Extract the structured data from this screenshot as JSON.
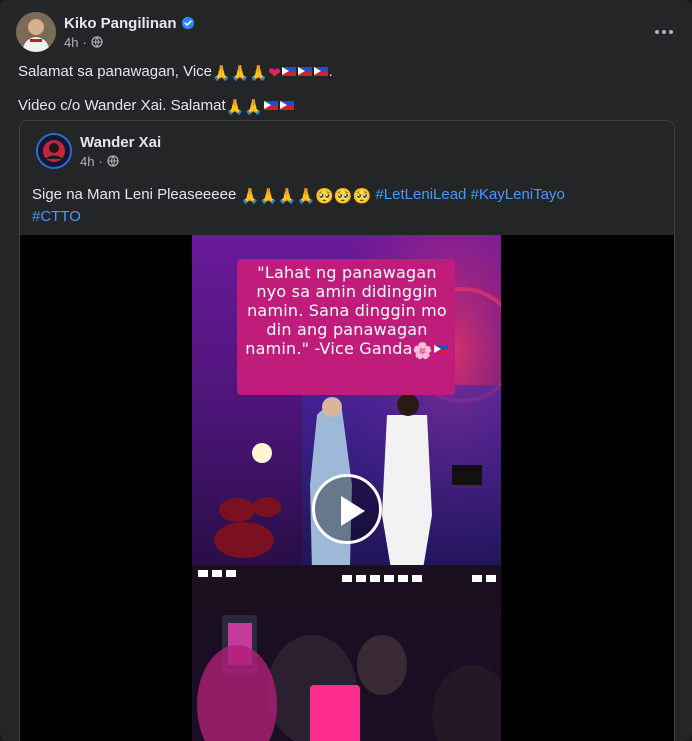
{
  "post": {
    "author_name": "Kiko Pangilinan",
    "timestamp": "4h",
    "line1": "Salamat sa panawagan, Vice",
    "line2": "Video c/o Wander Xai. Salamat"
  },
  "shared_post": {
    "author_name": "Wander Xai",
    "timestamp": "4h",
    "text": "Sige na Mam Leni Pleaseeeee",
    "hashtags": [
      "#LetLeniLead",
      "#KayLeniTayo",
      "#CTTO"
    ],
    "video_caption": "\"Lahat ng panawagan nyo sa amin didinggin namin. Sana dinggin mo din ang panawagan namin.\" -Vice Ganda"
  },
  "icons": {
    "verified": "verified-badge-icon",
    "privacy": "globe-icon",
    "more": "more-options-icon",
    "play": "play-icon"
  },
  "colors": {
    "background": "#242526",
    "text": "#e4e6eb",
    "secondary_text": "#b0b3b8",
    "hashtag": "#4599ff",
    "verified": "#2d88ff",
    "caption_box": "#c01c7c"
  }
}
